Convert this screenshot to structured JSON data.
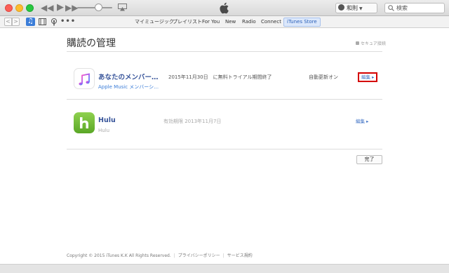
{
  "player": {
    "icons": [
      "rewind-icon",
      "play-icon",
      "fast-forward-icon",
      "airplay-icon",
      "apple-logo-icon"
    ],
    "volume": 0.6
  },
  "account": {
    "name": "和則"
  },
  "search": {
    "placeholder": "検索"
  },
  "toolbar": {
    "back": "<",
    "forward": ">",
    "library_icons": [
      "music-note-icon",
      "film-icon",
      "podcast-icon",
      "more-icon"
    ],
    "more": "•••",
    "tabs": [
      {
        "label": "マイミュージック"
      },
      {
        "label": "プレイリスト"
      },
      {
        "label": "For You"
      },
      {
        "label": "New"
      },
      {
        "label": "Radio"
      },
      {
        "label": "Connect"
      },
      {
        "label": "iTunes Store",
        "active": true
      }
    ]
  },
  "page": {
    "title": "購読の管理",
    "secure_label": "セキュア接続"
  },
  "subscriptions": [
    {
      "name": "あなたのメンバー…",
      "description": "Apple Music メンバーシ…",
      "date_text": "2015年11月30日　に無料トライアル期間終了",
      "status": "自動更新オン",
      "edit": "編集 ▸",
      "icon": "music-note-icon"
    },
    {
      "name": "Hulu",
      "description": "Hulu",
      "date_text": "有効期限 2013年11月7日",
      "status": "",
      "edit": "編集 ▸",
      "icon": "hulu-icon"
    }
  ],
  "done_label": "完了",
  "footer": {
    "copyright": "Copyright © 2015 iTunes K.K All Rights Reserved.",
    "privacy": "プライバシーポリシー",
    "terms": "サービス規約"
  },
  "colors": {
    "accent": "#3b7dd8",
    "link": "#37549a",
    "highlight": "#d40000",
    "hulu_green": "#6cbb2f"
  }
}
